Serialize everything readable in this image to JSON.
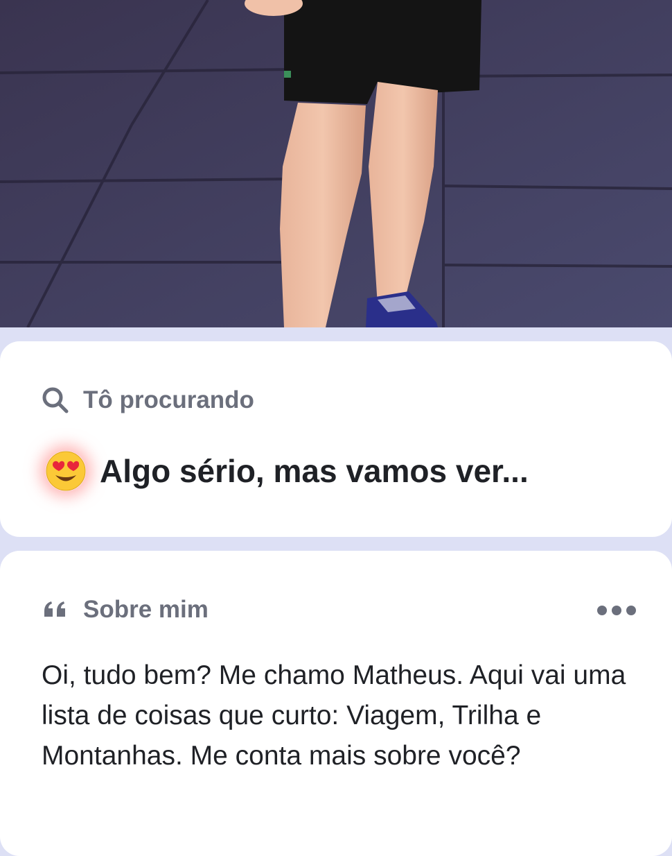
{
  "photo": {
    "alt": "",
    "floor_color": "#3d3a55"
  },
  "looking_for": {
    "icon": "search-icon",
    "heading": "Tô procurando",
    "emoji": "heart-eyes-emoji",
    "value": "Algo sério, mas vamos ver..."
  },
  "about": {
    "icon": "quote-icon",
    "heading": "Sobre mim",
    "more_icon": "more-dots-icon",
    "text": "Oi, tudo bem? Me chamo Matheus. Aqui vai uma lista de coisas que curto: Viagem, Trilha e Montanhas. Me conta mais sobre você?"
  },
  "colors": {
    "background": "#dde0f5",
    "card": "#ffffff",
    "muted_text": "#6b6f7c",
    "primary_text": "#1f2126"
  }
}
